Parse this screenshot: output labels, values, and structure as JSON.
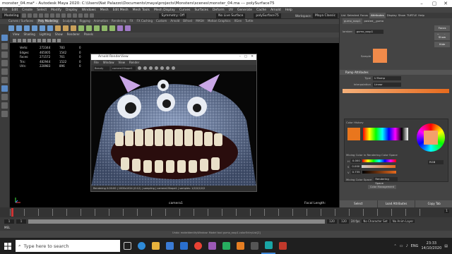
{
  "window": {
    "title": "monster_04.ma* - Autodesk Maya 2020: C:\\Users\\Nat Palazzo\\Documents\\maya\\projects\\Monsters\\scenes\\monster_04.ma  ---  polySurface75"
  },
  "menus": [
    "File",
    "Edit",
    "Create",
    "Select",
    "Modify",
    "Display",
    "Windows",
    "Mesh",
    "Edit Mesh",
    "Mesh Tools",
    "Mesh Display",
    "Curves",
    "Surfaces",
    "Deform",
    "UV",
    "Generate",
    "Cache",
    "Arnold",
    "Help"
  ],
  "shelf": {
    "mode": "Modeling",
    "symmetry": "Symmetry: Off",
    "no_live": "No Live Surface",
    "workspace_label": "Workspace:",
    "workspace": "Maya Classic",
    "object_field": "polySurface75"
  },
  "shelf_tabs": [
    "Curves / Surfaces",
    "Poly Modeling",
    "Sculpting",
    "Rigging",
    "Animation",
    "Rendering",
    "FX",
    "FX Caching",
    "Custom",
    "Arnold",
    "Bifrost",
    "MASH",
    "Motion Graphics",
    "XGen",
    "Turtle"
  ],
  "viewport": {
    "menu": [
      "View",
      "Shading",
      "Lighting",
      "Show",
      "Renderer",
      "Panels"
    ],
    "hud": [
      {
        "label": "Verts:",
        "a": "272344",
        "b": "783",
        "c": "0"
      },
      {
        "label": "Edges:",
        "a": "465005",
        "b": "1542",
        "c": "0"
      },
      {
        "label": "Faces:",
        "a": "271572",
        "b": "761",
        "c": "0"
      },
      {
        "label": "Tris:",
        "a": "482944",
        "b": "1522",
        "c": "0"
      },
      {
        "label": "UVs:",
        "a": "228983",
        "b": "896",
        "c": "0"
      }
    ],
    "camera": "camera1",
    "fps": "Focal Length:"
  },
  "render_view": {
    "title": "Arnold RenderView",
    "menu": [
      "File",
      "Window",
      "View",
      "Render"
    ],
    "camera_dd": "Beauty",
    "cam2": "camera1Shape1",
    "status": "Rendering 0:00:00  |  1000x1024 (0:12)  |  sampling  |  camera1Shape1  |  samples: 1/2/2/2/2/2"
  },
  "attr": {
    "tabs": [
      "List",
      "Selected",
      "Focus",
      "Attributes",
      "Display",
      "Show",
      "TURTLE",
      "Help"
    ],
    "node_tab": "gumo_sssp1",
    "node_tab2": "pasted__gumo",
    "label": "lamber:",
    "value": "gumo_sssp1",
    "focus": "Focus",
    "presets": "Presets",
    "show": "Show",
    "hide": "Hide",
    "swatch": "Sample",
    "section": "Ramp Attributes",
    "type_label": "Type",
    "type_value": "U Ramp",
    "interp_label": "Interpolation",
    "interp_value": "Linear",
    "history": "Color History",
    "mixing": "Mixing Color in Rendering Color Space",
    "h": "H",
    "s": "S",
    "v": "V",
    "hv": "0.000",
    "sv": "0.000",
    "vv": "0.735",
    "rgb": "RGB",
    "mix_label": "Mixing Color Space",
    "mix_value": "Rendering Space",
    "cm": "Color Management",
    "buttons": [
      "Select",
      "Load Attributes",
      "Copy Tab"
    ]
  },
  "time": {
    "start": "1",
    "frame": "1",
    "end": "120",
    "range_end": "120",
    "fps": "24 fps",
    "no_char": "No Character Set",
    "no_anim": "No Anim Layer"
  },
  "mel": "MEL",
  "help_line": "Undo: makeIdentityWindow: Model tool gumo_sssp1.colorEntryList[2]",
  "taskbar": {
    "search": "Type here to search",
    "time": "23:33",
    "date": "14/10/2020",
    "lang": "ENG"
  },
  "colors": {
    "accent": "#3f87d8",
    "tab_active": "#5285a6"
  }
}
